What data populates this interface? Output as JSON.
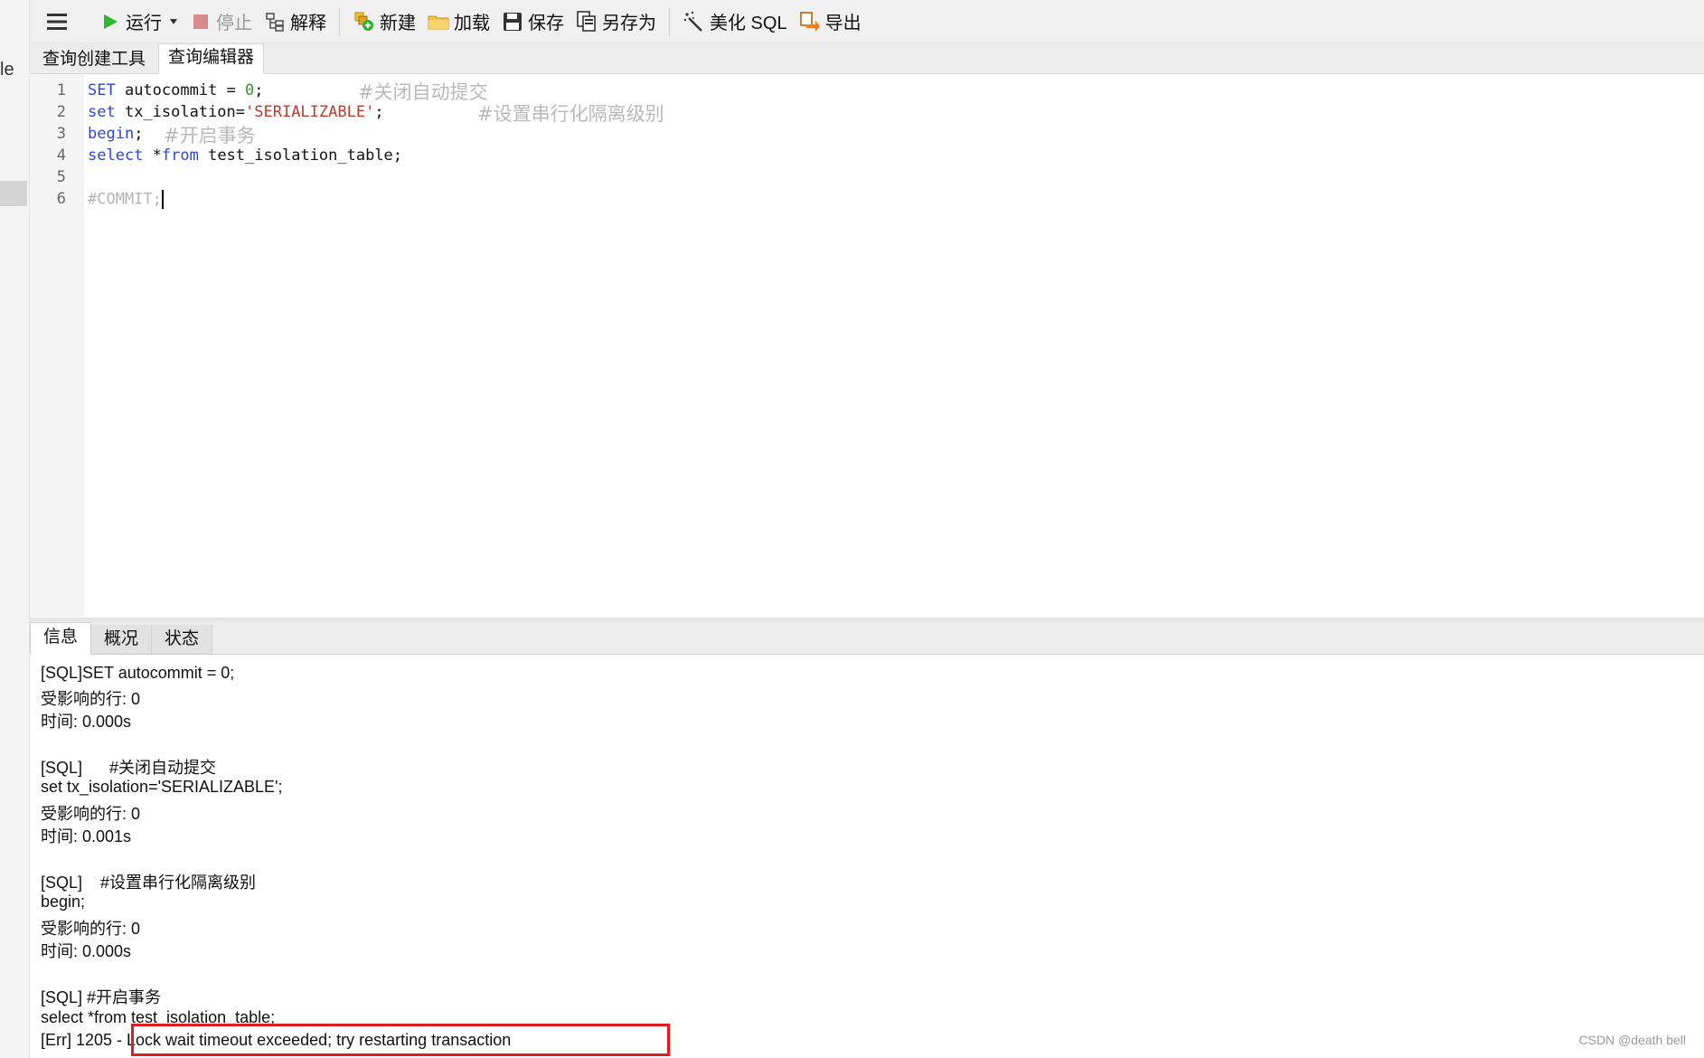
{
  "left_strip": {
    "label": "le"
  },
  "toolbar": {
    "run": "运行",
    "stop": "停止",
    "explain": "解释",
    "new": "新建",
    "load": "加载",
    "save": "保存",
    "save_as": "另存为",
    "beautify": "美化 SQL",
    "export": "导出"
  },
  "editor_tabs": [
    "查询创建工具",
    "查询编辑器"
  ],
  "editor": {
    "line_numbers": [
      "1",
      "2",
      "3",
      "4",
      "5",
      "6"
    ],
    "l1": {
      "kw": "SET",
      "rest": " autocommit = ",
      "num": "0",
      "end": ";",
      "comment": "#关闭自动提交"
    },
    "l2": {
      "kw": "set",
      "rest": " tx_isolation=",
      "str": "'SERIALIZABLE'",
      "end": ";",
      "comment": "#设置串行化隔离级别"
    },
    "l3": {
      "kw": "begin",
      "end": ";",
      "comment": "#开启事务"
    },
    "l4": {
      "kw": "select",
      "rest1": " *",
      "kw2": "from",
      "rest2": " test_isolation_table;"
    },
    "l6": {
      "comment": "#COMMIT;"
    }
  },
  "result_tabs": [
    "信息",
    "概况",
    "状态"
  ],
  "result_lines": [
    "[SQL]SET autocommit = 0;",
    "受影响的行: 0",
    "时间: 0.000s",
    "",
    "[SQL]      #关闭自动提交",
    "set tx_isolation='SERIALIZABLE';",
    "受影响的行: 0",
    "时间: 0.001s",
    "",
    "[SQL]    #设置串行化隔离级别",
    "begin;",
    "受影响的行: 0",
    "时间: 0.000s",
    "",
    "[SQL] #开启事务",
    "select *from test_isolation_table;",
    "[Err] 1205 - Lock wait timeout exceeded; try restarting transaction"
  ],
  "watermark": "CSDN @death bell",
  "colors": {
    "run_icon": "#2fb52f",
    "stop_icon": "#d98a8a",
    "sql_keyword": "#2f45d8",
    "sql_string": "#c0392b",
    "sql_number": "#2a9b2a",
    "sql_comment": "#b4b4b4",
    "error_highlight": "#e41b1b"
  }
}
